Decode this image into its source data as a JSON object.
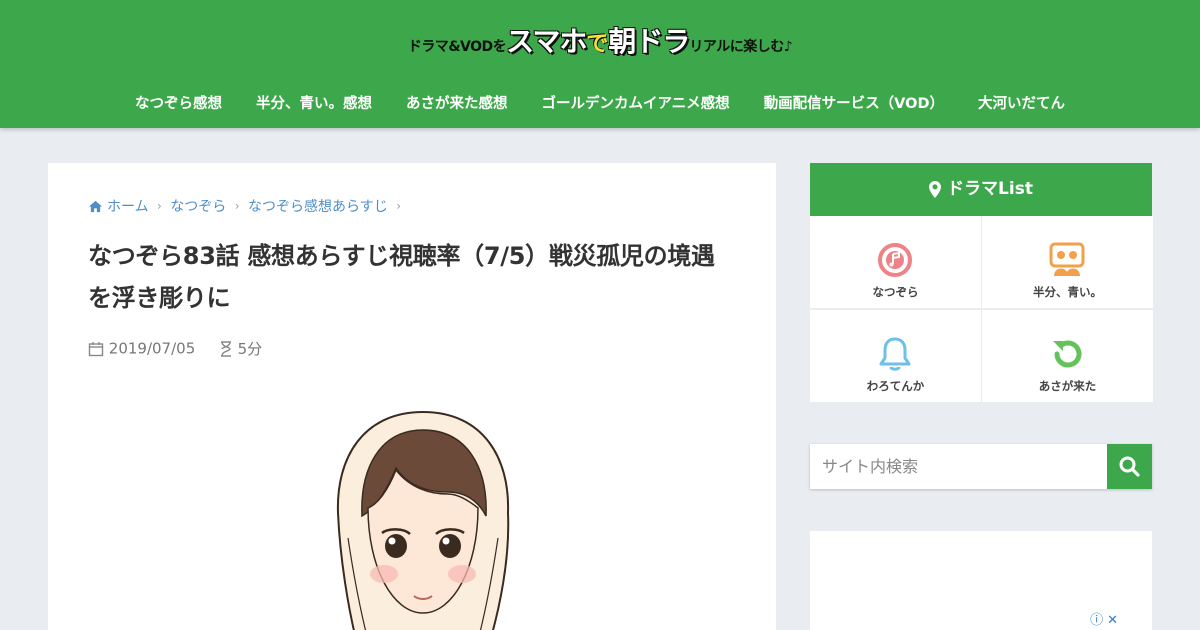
{
  "site": {
    "logo_prefix": "ドラマ&VODを",
    "logo_main_1": "スマホ",
    "logo_main_de": "で",
    "logo_main_2": "朝ドラ",
    "logo_suffix": "リアルに楽しむ♪"
  },
  "nav": {
    "items": [
      {
        "label": "なつぞら感想"
      },
      {
        "label": "半分、青い。感想"
      },
      {
        "label": "あさが来た感想"
      },
      {
        "label": "ゴールデンカムイアニメ感想"
      },
      {
        "label": "動画配信サービス（VOD）"
      },
      {
        "label": "大河いだてん"
      }
    ]
  },
  "breadcrumb": {
    "home": "ホーム",
    "level1": "なつぞら",
    "level2": "なつぞら感想あらすじ"
  },
  "article": {
    "title": "なつぞら83話 感想あらすじ視聴率（7/5）戦災孤児の境遇を浮き彫りに",
    "date": "2019/07/05",
    "read_time": "5分"
  },
  "sidebar": {
    "heading": "ドラマList",
    "items": [
      {
        "label": "なつぞら",
        "icon": "music-disc-icon",
        "color": "#ef8187"
      },
      {
        "label": "半分、青い。",
        "icon": "group-icon",
        "color": "#f3a04b"
      },
      {
        "label": "わろてんか",
        "icon": "bell-icon",
        "color": "#6cc0ea"
      },
      {
        "label": "あさが来た",
        "icon": "refresh-icon",
        "color": "#64c25a"
      }
    ]
  },
  "search": {
    "placeholder": "サイト内検索"
  },
  "colors": {
    "brand_green": "#3da84b",
    "link_blue": "#4f8fc9"
  }
}
